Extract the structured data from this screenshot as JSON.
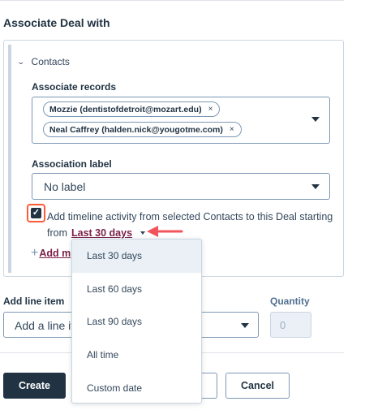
{
  "section_title": "Associate Deal with",
  "contacts": {
    "accordion_label": "Contacts",
    "associate_records_label": "Associate records",
    "records": [
      "Mozzie (dentistofdetroit@mozart.edu)",
      "Neal Caffrey (halden.nick@yougotme.com)"
    ],
    "remove_glyph": "×",
    "association_label": "Association label",
    "association_value": "No label",
    "timeline_text": "Add timeline activity from selected Contacts to this Deal starting",
    "timeline_from": "from",
    "timeline_period": "Last 30 days",
    "add_more": "Add m"
  },
  "line_item": {
    "label": "Add line item",
    "placeholder": "Add a line it",
    "quantity_label": "Quantity",
    "quantity_value": "0"
  },
  "dropdown": {
    "options": [
      "Last 30 days",
      "Last 60 days",
      "Last 90 days",
      "All time",
      "Custom date"
    ],
    "selected_index": 0
  },
  "buttons": {
    "create": "Create",
    "cancel": "Cancel"
  },
  "colors": {
    "dark": "#213343",
    "text": "#33475b",
    "border": "#7c98b6",
    "highlight": "#ff5c35",
    "link": "#7b2148",
    "arrow": "#f2545b"
  },
  "icons": {
    "accordion": "chevron-down-icon",
    "checkbox": "checkmark-icon",
    "select_caret": "caret-down-icon",
    "annotation": "left-arrow-icon"
  }
}
